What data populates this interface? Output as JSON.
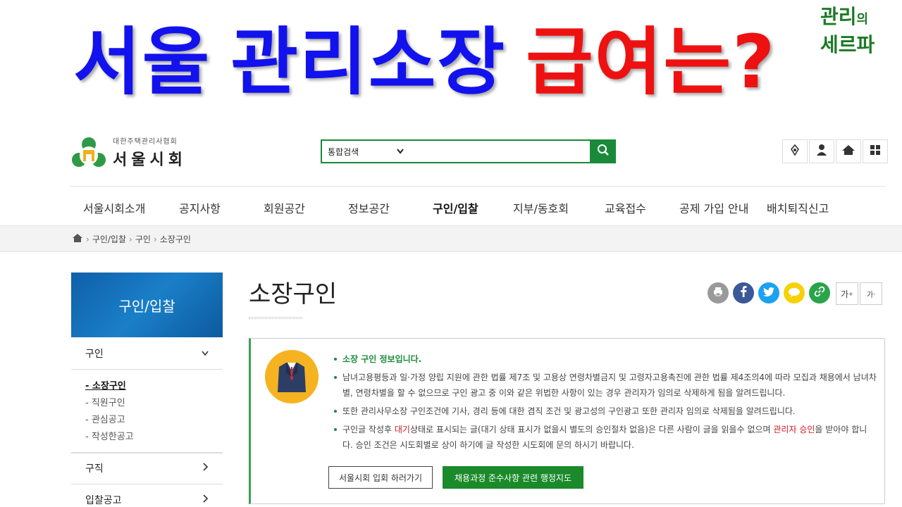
{
  "banner": {
    "title_part1": "서울",
    "title_part2": "관리소장",
    "title_part3": "급여는?",
    "brand_line1": "관리",
    "brand_line1_small": "의",
    "brand_line2": "세르파",
    "colors": {
      "blue": "#1212ee",
      "red": "#ee1111",
      "brand_green": "#1c7a26"
    }
  },
  "header": {
    "logo_sub": "대한주택관리사협회",
    "logo_main": "서울시회",
    "search": {
      "select_value": "통합검색",
      "placeholder": ""
    },
    "utility_icons": [
      "sitemap-icon",
      "user-icon",
      "home-icon",
      "grid-menu-icon"
    ]
  },
  "gnb": {
    "items": [
      "서울시회소개",
      "공지사항",
      "회원공간",
      "정보공간",
      "구인/입찰",
      "지부/동호회",
      "교육접수",
      "공제 가입 안내",
      "배치퇴직신고"
    ],
    "active_index": 4
  },
  "breadcrumb": [
    "구인/입찰",
    "구인",
    "소장구인"
  ],
  "lnb": {
    "head": "구인/입찰",
    "sections": [
      {
        "title": "구인",
        "sub": [
          "소장구인",
          "직원구인",
          "관심공고",
          "작성한공고"
        ]
      },
      {
        "title": "구직"
      },
      {
        "title": "입찰공고"
      }
    ]
  },
  "content": {
    "title": "소장구인",
    "font_larger": "가",
    "font_smaller": "가",
    "info": {
      "lead": "소장 구인 정보입니다.",
      "p1": "남녀고용평등과 일·가정 양립 지원에 관한 법률 제7조 및 고용상 연령차별금지 및 고령자고용촉진에 관한 법률 제4조의4에 따라 모집과 채용에서 남녀차별, 연령차별을 할 수 없으므로 구인 광고 중 이와 같은 위법한 사항이 있는 경우 관리자가 임의로 삭제하게 됨을 알려드립니다.",
      "p2": "또한 관리사무소장 구인조건에 기사, 경리 등에 대한 겸직 조건 및 광고성의 구인광고 또한 관리자 임의로 삭제됨을 알려드립니다.",
      "p3_a": "구인글 작성후 ",
      "p3_hl1": "대기",
      "p3_b": "상태로 표시되는 글(대기 상태 표시가 없을시 별도의 승인절차 없음)은 다른 사람이 글을 읽을수 없으며 ",
      "p3_hl2": "관리자 승인",
      "p3_c": "을 받아야 합니다. 승인 조건은 시도회별로 상이 하기에 글 작성한 시도회에 문의 하시기 바랍니다."
    },
    "btn_join": "서울시회 입회 하러가기",
    "btn_guide": "채용과정 준수사항 관련 행정지도"
  }
}
